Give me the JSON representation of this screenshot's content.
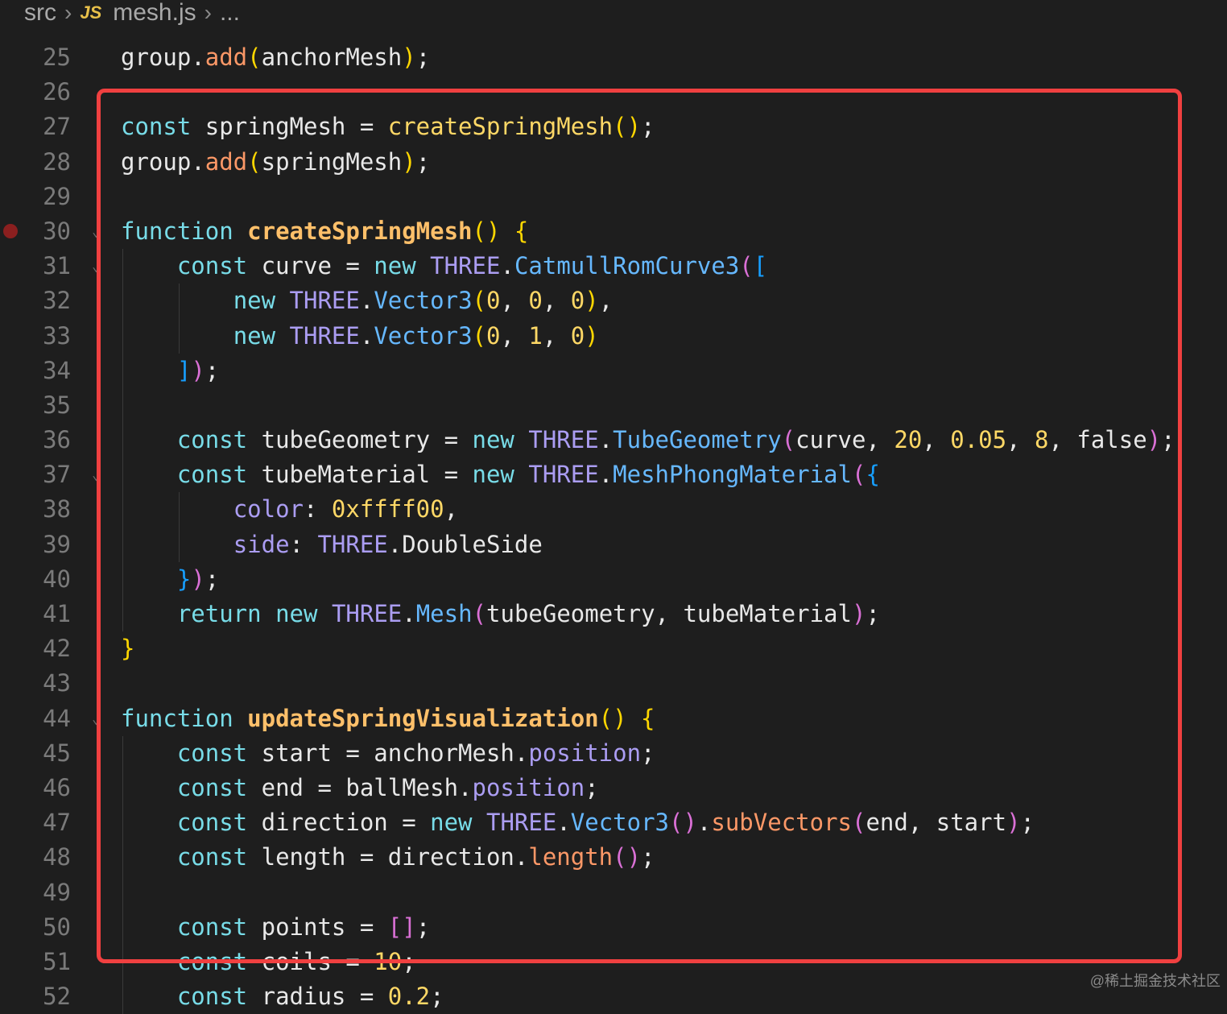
{
  "breadcrumb": {
    "folder": "src",
    "file_icon": "JS",
    "file": "mesh.js",
    "more": "..."
  },
  "editor": {
    "lines": [
      {
        "num": "25",
        "tokens": [
          [
            "plain",
            "group."
          ],
          [
            "mfn",
            "add"
          ],
          [
            "br1",
            "("
          ],
          [
            "plain",
            "anchorMesh"
          ],
          [
            "br1",
            ")"
          ],
          [
            "plain",
            ";"
          ]
        ]
      },
      {
        "num": "26",
        "tokens": []
      },
      {
        "num": "27",
        "tokens": [
          [
            "kw",
            "const"
          ],
          [
            "plain",
            " springMesh = "
          ],
          [
            "fn",
            "createSpringMesh"
          ],
          [
            "br1",
            "()"
          ],
          [
            "plain",
            ";"
          ]
        ]
      },
      {
        "num": "28",
        "tokens": [
          [
            "plain",
            "group."
          ],
          [
            "mfn",
            "add"
          ],
          [
            "br1",
            "("
          ],
          [
            "plain",
            "springMesh"
          ],
          [
            "br1",
            ")"
          ],
          [
            "plain",
            ";"
          ]
        ]
      },
      {
        "num": "29",
        "tokens": []
      },
      {
        "num": "30",
        "fold": true,
        "breakpoint": true,
        "tokens": [
          [
            "kw",
            "function"
          ],
          [
            "plain",
            " "
          ],
          [
            "fnb",
            "createSpringMesh"
          ],
          [
            "br1",
            "()"
          ],
          [
            "plain",
            " "
          ],
          [
            "br1",
            "{"
          ]
        ]
      },
      {
        "num": "31",
        "fold": true,
        "guides": 1,
        "tokens": [
          [
            "plain",
            "    "
          ],
          [
            "kw",
            "const"
          ],
          [
            "plain",
            " curve = "
          ],
          [
            "kw",
            "new"
          ],
          [
            "plain",
            " "
          ],
          [
            "cls",
            "THREE"
          ],
          [
            "plain",
            "."
          ],
          [
            "meth",
            "CatmullRomCurve3"
          ],
          [
            "br2",
            "("
          ],
          [
            "br3",
            "["
          ]
        ]
      },
      {
        "num": "32",
        "guides": 2,
        "tokens": [
          [
            "plain",
            "        "
          ],
          [
            "kw",
            "new"
          ],
          [
            "plain",
            " "
          ],
          [
            "cls",
            "THREE"
          ],
          [
            "plain",
            "."
          ],
          [
            "meth",
            "Vector3"
          ],
          [
            "br1",
            "("
          ],
          [
            "num",
            "0"
          ],
          [
            "plain",
            ", "
          ],
          [
            "num",
            "0"
          ],
          [
            "plain",
            ", "
          ],
          [
            "num",
            "0"
          ],
          [
            "br1",
            ")"
          ],
          [
            "plain",
            ","
          ]
        ]
      },
      {
        "num": "33",
        "guides": 2,
        "tokens": [
          [
            "plain",
            "        "
          ],
          [
            "kw",
            "new"
          ],
          [
            "plain",
            " "
          ],
          [
            "cls",
            "THREE"
          ],
          [
            "plain",
            "."
          ],
          [
            "meth",
            "Vector3"
          ],
          [
            "br1",
            "("
          ],
          [
            "num",
            "0"
          ],
          [
            "plain",
            ", "
          ],
          [
            "num",
            "1"
          ],
          [
            "plain",
            ", "
          ],
          [
            "num",
            "0"
          ],
          [
            "br1",
            ")"
          ]
        ]
      },
      {
        "num": "34",
        "guides": 1,
        "tokens": [
          [
            "plain",
            "    "
          ],
          [
            "br3",
            "]"
          ],
          [
            "br2",
            ")"
          ],
          [
            "plain",
            ";"
          ]
        ]
      },
      {
        "num": "35",
        "guides": 1,
        "tokens": []
      },
      {
        "num": "36",
        "guides": 1,
        "tokens": [
          [
            "plain",
            "    "
          ],
          [
            "kw",
            "const"
          ],
          [
            "plain",
            " tubeGeometry = "
          ],
          [
            "kw",
            "new"
          ],
          [
            "plain",
            " "
          ],
          [
            "cls",
            "THREE"
          ],
          [
            "plain",
            "."
          ],
          [
            "meth",
            "TubeGeometry"
          ],
          [
            "br2",
            "("
          ],
          [
            "plain",
            "curve, "
          ],
          [
            "num",
            "20"
          ],
          [
            "plain",
            ", "
          ],
          [
            "num",
            "0.05"
          ],
          [
            "plain",
            ", "
          ],
          [
            "num",
            "8"
          ],
          [
            "plain",
            ", false"
          ],
          [
            "br2",
            ")"
          ],
          [
            "plain",
            ";"
          ]
        ]
      },
      {
        "num": "37",
        "fold": true,
        "guides": 1,
        "tokens": [
          [
            "plain",
            "    "
          ],
          [
            "kw",
            "const"
          ],
          [
            "plain",
            " tubeMaterial = "
          ],
          [
            "kw",
            "new"
          ],
          [
            "plain",
            " "
          ],
          [
            "cls",
            "THREE"
          ],
          [
            "plain",
            "."
          ],
          [
            "meth",
            "MeshPhongMaterial"
          ],
          [
            "br2",
            "("
          ],
          [
            "br3",
            "{"
          ]
        ]
      },
      {
        "num": "38",
        "guides": 2,
        "tokens": [
          [
            "plain",
            "        "
          ],
          [
            "prop",
            "color"
          ],
          [
            "plain",
            ": "
          ],
          [
            "num",
            "0xffff00"
          ],
          [
            "plain",
            ","
          ]
        ]
      },
      {
        "num": "39",
        "guides": 2,
        "tokens": [
          [
            "plain",
            "        "
          ],
          [
            "prop",
            "side"
          ],
          [
            "plain",
            ": "
          ],
          [
            "cls",
            "THREE"
          ],
          [
            "plain",
            ".DoubleSide"
          ]
        ]
      },
      {
        "num": "40",
        "guides": 1,
        "tokens": [
          [
            "plain",
            "    "
          ],
          [
            "br3",
            "}"
          ],
          [
            "br2",
            ")"
          ],
          [
            "plain",
            ";"
          ]
        ]
      },
      {
        "num": "41",
        "guides": 1,
        "tokens": [
          [
            "plain",
            "    "
          ],
          [
            "kw",
            "return"
          ],
          [
            "plain",
            " "
          ],
          [
            "kw",
            "new"
          ],
          [
            "plain",
            " "
          ],
          [
            "cls",
            "THREE"
          ],
          [
            "plain",
            "."
          ],
          [
            "meth",
            "Mesh"
          ],
          [
            "br2",
            "("
          ],
          [
            "plain",
            "tubeGeometry, tubeMaterial"
          ],
          [
            "br2",
            ")"
          ],
          [
            "plain",
            ";"
          ]
        ]
      },
      {
        "num": "42",
        "tokens": [
          [
            "br1",
            "}"
          ]
        ]
      },
      {
        "num": "43",
        "tokens": []
      },
      {
        "num": "44",
        "fold": true,
        "tokens": [
          [
            "kw",
            "function"
          ],
          [
            "plain",
            " "
          ],
          [
            "fnb",
            "updateSpringVisualization"
          ],
          [
            "br1",
            "()"
          ],
          [
            "plain",
            " "
          ],
          [
            "br1",
            "{"
          ]
        ]
      },
      {
        "num": "45",
        "guides": 1,
        "tokens": [
          [
            "plain",
            "    "
          ],
          [
            "kw",
            "const"
          ],
          [
            "plain",
            " start = anchorMesh."
          ],
          [
            "prop",
            "position"
          ],
          [
            "plain",
            ";"
          ]
        ]
      },
      {
        "num": "46",
        "guides": 1,
        "tokens": [
          [
            "plain",
            "    "
          ],
          [
            "kw",
            "const"
          ],
          [
            "plain",
            " end = ballMesh."
          ],
          [
            "prop",
            "position"
          ],
          [
            "plain",
            ";"
          ]
        ]
      },
      {
        "num": "47",
        "guides": 1,
        "tokens": [
          [
            "plain",
            "    "
          ],
          [
            "kw",
            "const"
          ],
          [
            "plain",
            " direction = "
          ],
          [
            "kw",
            "new"
          ],
          [
            "plain",
            " "
          ],
          [
            "cls",
            "THREE"
          ],
          [
            "plain",
            "."
          ],
          [
            "meth",
            "Vector3"
          ],
          [
            "br2",
            "()"
          ],
          [
            "plain",
            "."
          ],
          [
            "mfn",
            "subVectors"
          ],
          [
            "br2",
            "("
          ],
          [
            "plain",
            "end, start"
          ],
          [
            "br2",
            ")"
          ],
          [
            "plain",
            ";"
          ]
        ]
      },
      {
        "num": "48",
        "guides": 1,
        "tokens": [
          [
            "plain",
            "    "
          ],
          [
            "kw",
            "const"
          ],
          [
            "plain",
            " length = direction."
          ],
          [
            "mfn",
            "length"
          ],
          [
            "br2",
            "()"
          ],
          [
            "plain",
            ";"
          ]
        ]
      },
      {
        "num": "49",
        "guides": 1,
        "tokens": []
      },
      {
        "num": "50",
        "guides": 1,
        "tokens": [
          [
            "plain",
            "    "
          ],
          [
            "kw",
            "const"
          ],
          [
            "plain",
            " points = "
          ],
          [
            "br2",
            "[]"
          ],
          [
            "plain",
            ";"
          ]
        ]
      },
      {
        "num": "51",
        "guides": 1,
        "tokens": [
          [
            "plain",
            "    "
          ],
          [
            "kw",
            "const"
          ],
          [
            "plain",
            " coils = "
          ],
          [
            "num",
            "10"
          ],
          [
            "plain",
            ";"
          ]
        ]
      },
      {
        "num": "52",
        "guides": 1,
        "tokens": [
          [
            "plain",
            "    "
          ],
          [
            "kw",
            "const"
          ],
          [
            "plain",
            " radius = "
          ],
          [
            "num",
            "0.2"
          ],
          [
            "plain",
            ";"
          ]
        ]
      }
    ]
  },
  "watermark": "@稀土掘金技术社区",
  "colors": {
    "background": "#1e1e1e",
    "highlight_border": "#f04040",
    "keyword": "#78dce8",
    "function": "#ffd866",
    "class": "#ab9df2",
    "method": "#66b8ff"
  }
}
